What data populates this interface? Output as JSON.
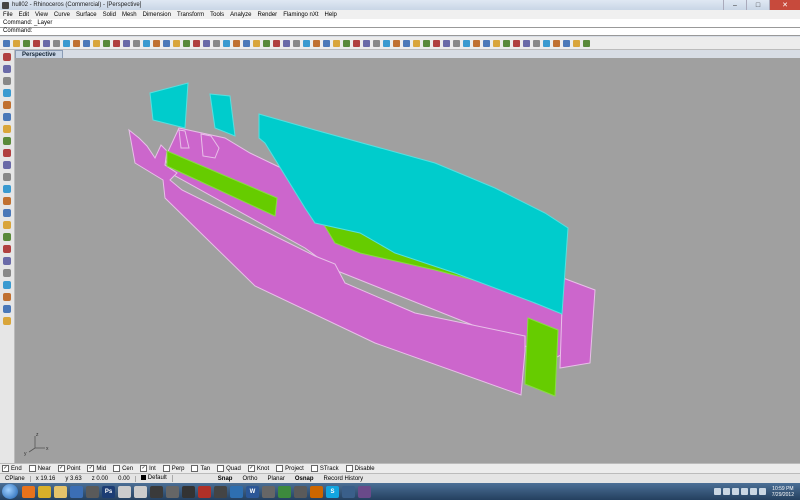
{
  "window": {
    "title": "hull02 - Rhinoceros (Commercial) - [Perspective]",
    "controls": [
      "–",
      "□",
      "✕"
    ]
  },
  "menu": [
    "File",
    "Edit",
    "View",
    "Curve",
    "Surface",
    "Solid",
    "Mesh",
    "Dimension",
    "Transform",
    "Tools",
    "Analyze",
    "Render",
    "Flamingo nXt",
    "Help"
  ],
  "command": {
    "history": "Command: _Layer",
    "prompt": "Command:",
    "value": ""
  },
  "toolbar": {
    "icons": [
      "new-icon",
      "open-icon",
      "save-icon",
      "print-icon",
      "import-icon",
      "cut-icon",
      "copy-icon",
      "paste-icon",
      "undo-icon",
      "redo-icon",
      "pan-icon",
      "rotate-icon",
      "zoom-icon",
      "zoom-window-icon",
      "zoom-extents-icon",
      "zoom-selected-icon",
      "four-view-icon",
      "grid-icon",
      "wireframe-icon",
      "shaded-icon",
      "rendered-icon",
      "light-icon",
      "select-icon",
      "hide-icon",
      "show-icon",
      "lock-icon",
      "unlock-icon",
      "layer-icon",
      "material-icon",
      "render-icon",
      "sphere-icon",
      "help-icon",
      "box-icon",
      "cylinder-icon",
      "extrude-icon",
      "loft-icon",
      "sweep-icon",
      "revolve-icon",
      "trim-icon",
      "split-icon",
      "join-icon",
      "explode-icon",
      "group-icon",
      "ungroup-icon",
      "move-icon",
      "scale-icon",
      "mirror-icon",
      "array-icon",
      "fillet-icon",
      "chamfer-icon",
      "offset-icon",
      "project-icon",
      "analyze-icon",
      "measure-icon",
      "dimension-icon",
      "text-icon",
      "snapshot-icon",
      "options-icon",
      "properties-icon"
    ],
    "colors": [
      "#4a78b8",
      "#d9a53a",
      "#5a8a3a",
      "#b04040",
      "#6a6aa8",
      "#888888",
      "#3a9ad0",
      "#c07030"
    ]
  },
  "sidebar": {
    "icons": [
      "select-arrow-icon",
      "point-icon",
      "polyline-icon",
      "curve-icon",
      "circle-icon",
      "arc-icon",
      "ellipse-icon",
      "rectangle-icon",
      "polygon-icon",
      "surface-icon",
      "extrude-surface-icon",
      "box-solid-icon",
      "sphere-solid-icon",
      "boolean-icon",
      "fillet-edge-icon",
      "mesh-icon",
      "text-object-icon",
      "transform-icon",
      "curve-from-object-icon",
      "analyze-curve-icon",
      "dimension-tool-icon",
      "block-icon",
      "render-tool-icon"
    ]
  },
  "viewport": {
    "label": "Perspective",
    "background": "#a0a0a0",
    "colors": {
      "cyan": "#00cccc",
      "magenta": "#cc66cc",
      "green": "#66cc00",
      "edge": "#e0c8e0"
    }
  },
  "osnap": [
    {
      "label": "End",
      "checked": true
    },
    {
      "label": "Near",
      "checked": false
    },
    {
      "label": "Point",
      "checked": true
    },
    {
      "label": "Mid",
      "checked": true
    },
    {
      "label": "Cen",
      "checked": false
    },
    {
      "label": "Int",
      "checked": true
    },
    {
      "label": "Perp",
      "checked": false
    },
    {
      "label": "Tan",
      "checked": false
    },
    {
      "label": "Quad",
      "checked": false
    },
    {
      "label": "Knot",
      "checked": true
    },
    {
      "label": "Project",
      "checked": false
    },
    {
      "label": "STrack",
      "checked": false
    },
    {
      "label": "Disable",
      "checked": false
    }
  ],
  "status": {
    "cplane": "CPlane",
    "x": "x 19.16",
    "y": "y 3.63",
    "z": "z 0.00",
    "dist": "0.00",
    "layer": "Default",
    "snap": "Snap",
    "ortho": "Ortho",
    "planar": "Planar",
    "osnap": "Osnap",
    "history": "Record History"
  },
  "taskbar": {
    "apps": [
      {
        "name": "firefox",
        "color": "#e8721c",
        "label": ""
      },
      {
        "name": "chrome",
        "color": "#d8b02a",
        "label": ""
      },
      {
        "name": "explorer",
        "color": "#e5c36a",
        "label": ""
      },
      {
        "name": "media",
        "color": "#3b6eb5",
        "label": ""
      },
      {
        "name": "app5",
        "color": "#5a5a5a",
        "label": ""
      },
      {
        "name": "photoshop",
        "color": "#1c3d74",
        "label": "Ps"
      },
      {
        "name": "app7",
        "color": "#cccccc",
        "label": ""
      },
      {
        "name": "app8",
        "color": "#cccccc",
        "label": ""
      },
      {
        "name": "app9",
        "color": "#3a3a3a",
        "label": ""
      },
      {
        "name": "app10",
        "color": "#666666",
        "label": ""
      },
      {
        "name": "app11",
        "color": "#333333",
        "label": ""
      },
      {
        "name": "app12",
        "color": "#b03028",
        "label": ""
      },
      {
        "name": "app13",
        "color": "#444444",
        "label": ""
      },
      {
        "name": "app14",
        "color": "#2e6fb0",
        "label": ""
      },
      {
        "name": "word",
        "color": "#2b5797",
        "label": "W"
      },
      {
        "name": "app16",
        "color": "#666666",
        "label": ""
      },
      {
        "name": "app17",
        "color": "#3d8a3d",
        "label": ""
      },
      {
        "name": "app18",
        "color": "#5a5a5a",
        "label": ""
      },
      {
        "name": "app19",
        "color": "#cc6600",
        "label": ""
      },
      {
        "name": "skype",
        "color": "#12a5e0",
        "label": "S"
      },
      {
        "name": "app21",
        "color": "#3a5f8a",
        "label": ""
      },
      {
        "name": "app22",
        "color": "#6a4a8a",
        "label": ""
      }
    ],
    "time": "10:59 PM",
    "date": "7/29/2012"
  }
}
